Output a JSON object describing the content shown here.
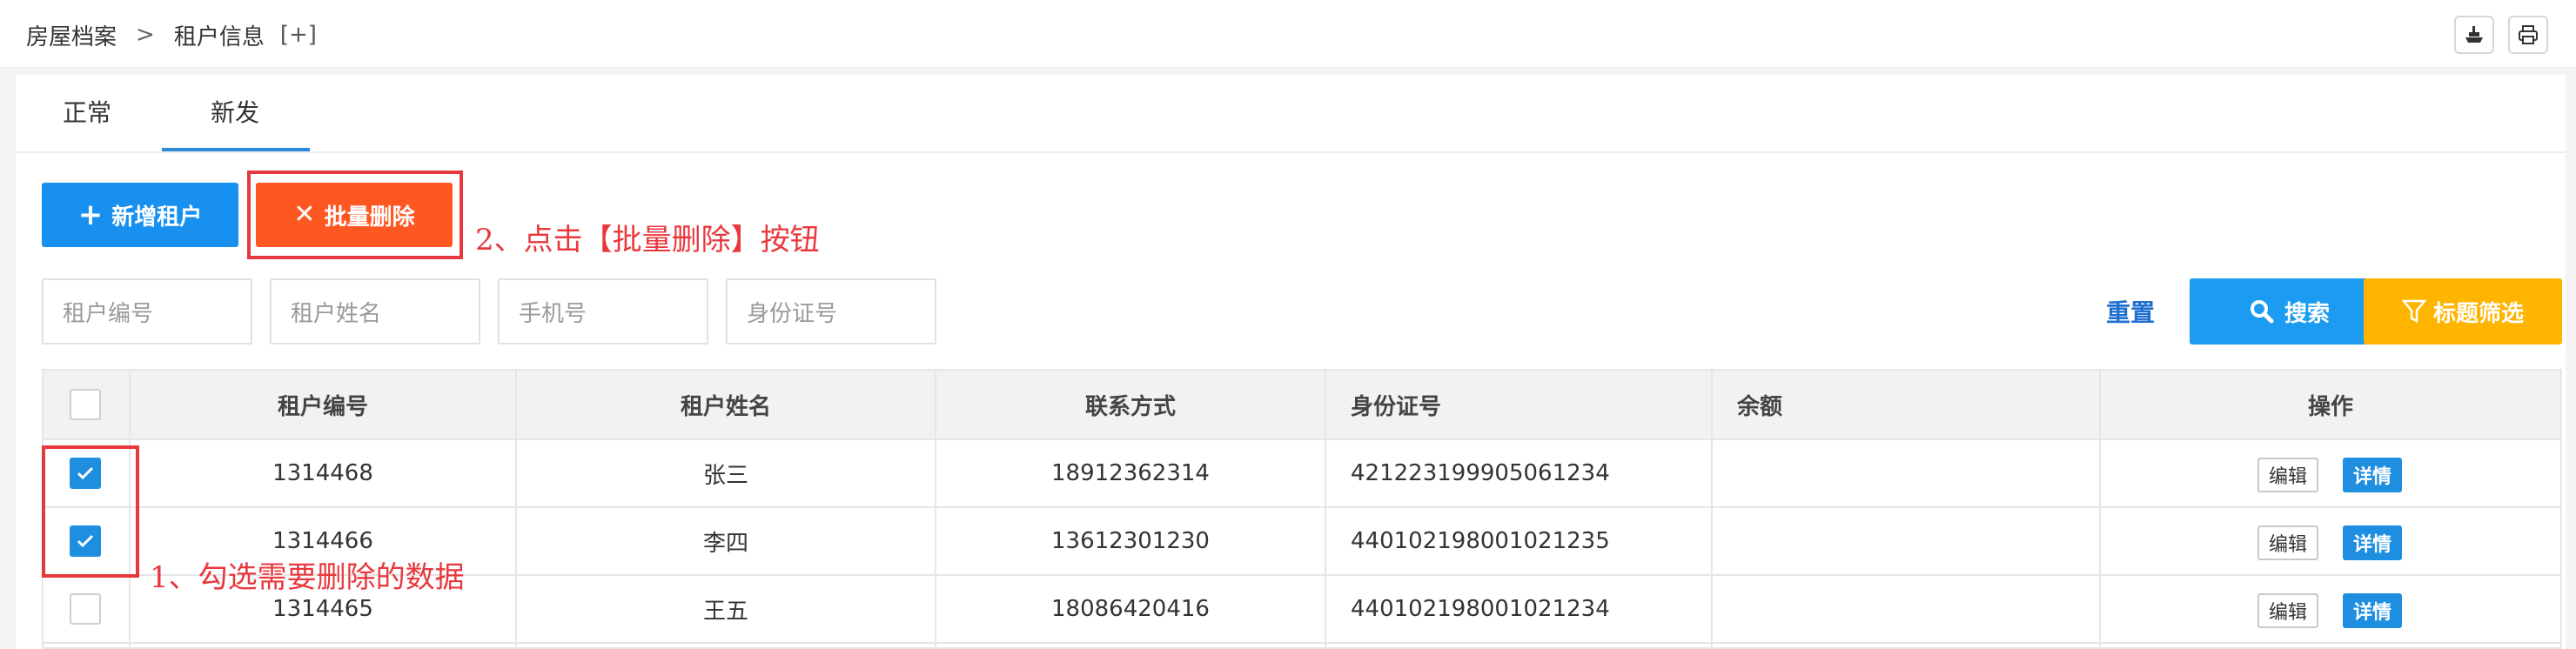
{
  "breadcrumb": {
    "root": "房屋档案",
    "separator": ">",
    "current": "租户信息",
    "expand": "[+]"
  },
  "tabs": [
    "正常",
    "新发"
  ],
  "toolbar": {
    "add": "新增租户",
    "batch_delete": "批量删除"
  },
  "annotations": {
    "step2": "2、点击【批量删除】按钮",
    "step1": "1、勾选需要删除的数据"
  },
  "filters": {
    "tenant_id": "租户编号",
    "tenant_name": "租户姓名",
    "phone": "手机号",
    "id_card": "身份证号"
  },
  "actions": {
    "reset": "重置",
    "search": "搜索",
    "title_filter": "标题筛选"
  },
  "table": {
    "headers": [
      "租户编号",
      "租户姓名",
      "联系方式",
      "身份证号",
      "余额",
      "操作"
    ],
    "rows": [
      {
        "checked": true,
        "id": "1314468",
        "name": "张三",
        "phone": "18912362314",
        "id_card": "421223199905061234",
        "balance": ""
      },
      {
        "checked": true,
        "id": "1314466",
        "name": "李四",
        "phone": "13612301230",
        "id_card": "440102198001021235",
        "balance": ""
      },
      {
        "checked": false,
        "id": "1314465",
        "name": "王五",
        "phone": "18086420416",
        "id_card": "440102198001021234",
        "balance": ""
      }
    ],
    "row_actions": {
      "edit": "编辑",
      "detail": "详情"
    }
  },
  "colors": {
    "primary": "#1890ef",
    "danger": "#ff5722",
    "warning": "#ffb400",
    "annotation": "#e8383d"
  }
}
